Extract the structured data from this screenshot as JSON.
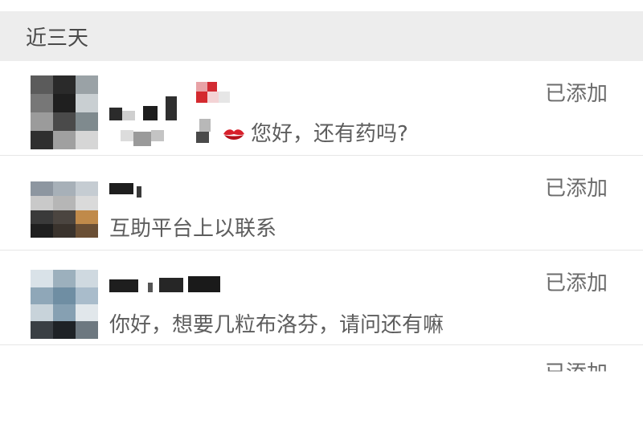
{
  "section": {
    "title": "近三天"
  },
  "requests": [
    {
      "message": "您好，还有药吗?",
      "status": "已添加",
      "emoji": "kiss-mark-emoji"
    },
    {
      "message": "互助平台上以联系",
      "status": "已添加"
    },
    {
      "message": "你好，想要几粒布洛芬，请问还有嘛",
      "status": "已添加"
    },
    {
      "status": "已添加"
    }
  ]
}
